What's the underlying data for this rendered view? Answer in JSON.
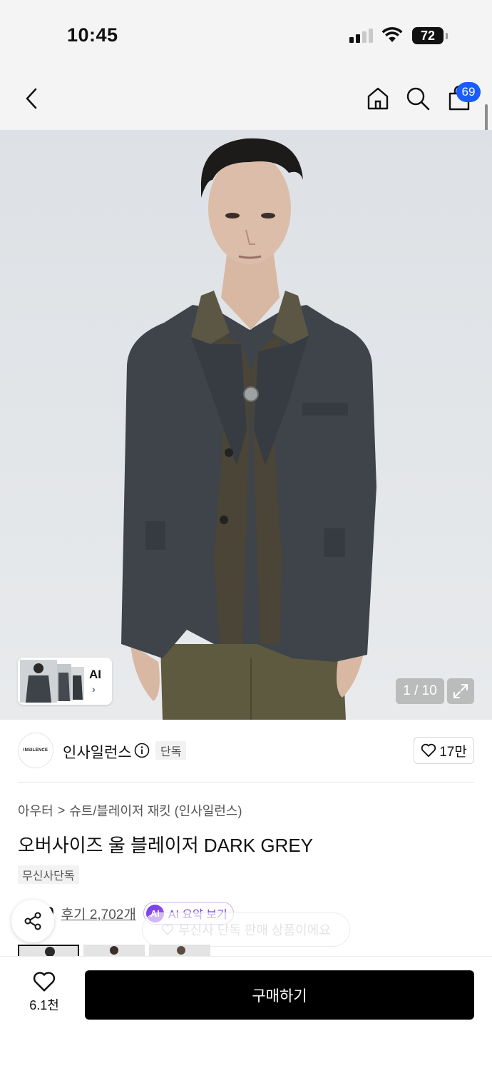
{
  "status_bar": {
    "time": "10:45",
    "battery": "72"
  },
  "nav": {
    "cart_count": "69"
  },
  "gallery": {
    "counter": "1 / 10",
    "ai_label": "AI",
    "ai_chevron": "›"
  },
  "brand": {
    "logo_text": "INSILENCE",
    "name": "인사일런스",
    "exclusive_label": "단독",
    "likes": "17만"
  },
  "breadcrumb": {
    "category": "아우터",
    "separator": ">",
    "subcategory": "슈트/블레이저 재킷 (인사일런스)"
  },
  "product": {
    "title": "오버사이즈 울 블레이저 DARK GREY",
    "tag": "무신사단독"
  },
  "reviews": {
    "rating_partial": "9",
    "review_link": "후기 2,702개",
    "ai_badge": "AI",
    "ai_summary_label": "AI 요약 보기"
  },
  "toast": {
    "text": "무신사 단독 판매 상품이에요"
  },
  "bottom": {
    "wish_count": "6.1천",
    "buy_label": "구매하기"
  },
  "icons": {
    "back": "back-arrow-icon",
    "home": "home-icon",
    "search": "search-icon",
    "cart": "shopping-bag-icon",
    "expand": "expand-icon",
    "info": "info-icon",
    "heart": "heart-icon",
    "share": "share-icon",
    "wifi": "wifi-icon",
    "signal": "signal-icon"
  },
  "colors": {
    "badge_blue": "#1a5cff",
    "ai_purple": "#7a3fe4",
    "buy_button": "#000000"
  }
}
